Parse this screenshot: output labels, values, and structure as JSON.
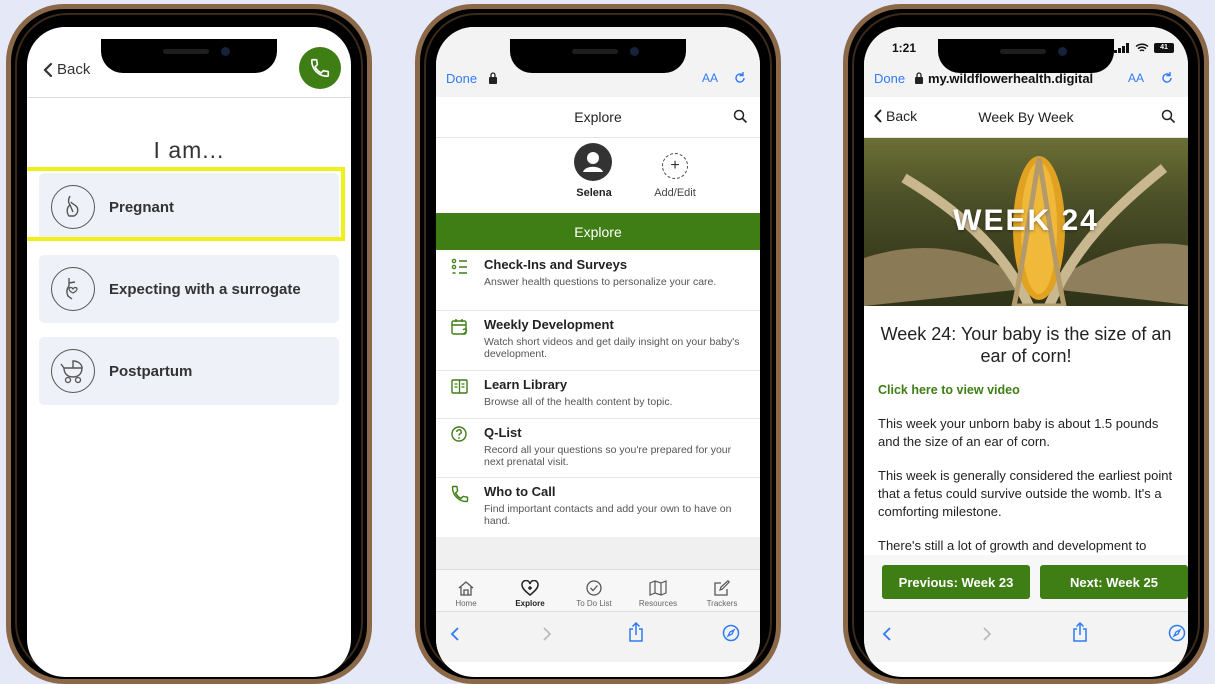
{
  "colors": {
    "brand_green": "#3f7d15",
    "highlight_yellow": "#f3ef19",
    "background": "#e4e8f7",
    "phone_frame": "#8a6848"
  },
  "phone1": {
    "back_label": "Back",
    "call_icon": "phone-icon",
    "title": "I am...",
    "options": [
      {
        "label": "Pregnant",
        "icon": "pregnant-icon",
        "highlighted": true
      },
      {
        "label": "Expecting with a surrogate",
        "icon": "surrogate-icon",
        "highlighted": false
      },
      {
        "label": "Postpartum",
        "icon": "stroller-icon",
        "highlighted": false
      }
    ]
  },
  "phone2": {
    "safari": {
      "done": "Done",
      "text_size": "AA"
    },
    "header_title": "Explore",
    "profile": {
      "name": "Selena",
      "add_label": "Add/Edit"
    },
    "section_bar": "Explore",
    "items": [
      {
        "title": "Check-Ins and Surveys",
        "desc": "Answer health questions to personalize your care.",
        "icon": "checklist-icon"
      },
      {
        "title": "Weekly Development",
        "desc": "Watch short videos and get daily insight on your baby's development.",
        "icon": "calendar-heart-icon"
      },
      {
        "title": "Learn Library",
        "desc": "Browse all of the health content by topic.",
        "icon": "book-icon"
      },
      {
        "title": "Q-List",
        "desc": "Record all your questions so you're prepared for your next prenatal visit.",
        "icon": "question-icon"
      },
      {
        "title": "Who to Call",
        "desc": "Find important contacts and add your own to have on hand.",
        "icon": "phone-icon"
      }
    ],
    "tabs": [
      {
        "label": "Home",
        "icon": "home-icon",
        "active": false
      },
      {
        "label": "Explore",
        "icon": "heart-plus-icon",
        "active": true
      },
      {
        "label": "To Do List",
        "icon": "check-circle-icon",
        "active": false
      },
      {
        "label": "Resources",
        "icon": "map-icon",
        "active": false
      },
      {
        "label": "Trackers",
        "icon": "edit-icon",
        "active": false
      }
    ]
  },
  "phone3": {
    "status": {
      "time": "1:21",
      "battery": "41"
    },
    "safari": {
      "done": "Done",
      "url": "my.wildflowerhealth.digital",
      "text_size": "AA"
    },
    "header": {
      "back": "Back",
      "title": "Week By Week"
    },
    "hero_text": "WEEK 24",
    "heading": "Week 24: Your baby is the size of an ear of corn!",
    "video_link": "Click here to view video",
    "paragraphs": [
      "This week your unborn baby is about 1.5 pounds and the size of an ear of corn.",
      "This week is generally considered the earliest point that a fetus could survive outside the womb. It's a comforting milestone.",
      "There's still a lot of growth and development to"
    ],
    "prev_button": "Previous: Week 23",
    "next_button": "Next: Week 25"
  }
}
